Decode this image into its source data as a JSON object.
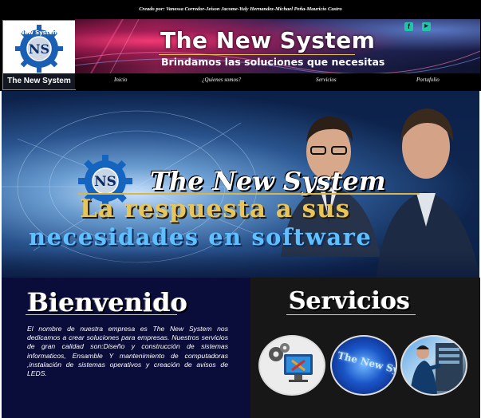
{
  "header": {
    "credits": "Creado por: Vanessa Corredor-Jeison Jacome-Yuly Hernandez-Michael Peña-Mauricio Castro",
    "logo_initials": "NS",
    "logo_ring_text": "New System",
    "logo_caption": "The New System",
    "title": "The New System",
    "subtitle": "Brindamos las soluciones que necesitas",
    "social": [
      {
        "icon": "facebook-icon",
        "glyph": "f"
      },
      {
        "icon": "youtube-icon",
        "glyph": "▶"
      }
    ]
  },
  "nav": {
    "items": [
      "Inicio",
      "¿Quienes somos?",
      "Servicios",
      "Portafolio"
    ]
  },
  "hero": {
    "gear_initials": "NS",
    "brand": "The New System",
    "line1": "La respuesta a sus",
    "line2": "necesidades en software"
  },
  "welcome": {
    "heading": "Bienvenido",
    "text": "El nombre de nuestra empresa es The New System nos dedicamos a crear soluciones para empresas. Nuestros servicios de gran calidad son:Diseño y construcción de sistemas informaticos, Ensamble Y mantenimiento de computadoras ,instalación de sistemas operativos y creación de avisos de LEDS."
  },
  "services": {
    "heading": "Servicios",
    "items": [
      {
        "icon": "computer-repair-icon"
      },
      {
        "icon": "led-sign-image",
        "text": "The New Syste"
      },
      {
        "icon": "technician-image"
      }
    ]
  },
  "colors": {
    "header_bg": "#000000",
    "welcome_bg": "#0a0c3a",
    "services_bg": "#171717",
    "gold": "#e8c559",
    "cyan_text": "#5ec0ff",
    "social": "#1fc7a6"
  }
}
